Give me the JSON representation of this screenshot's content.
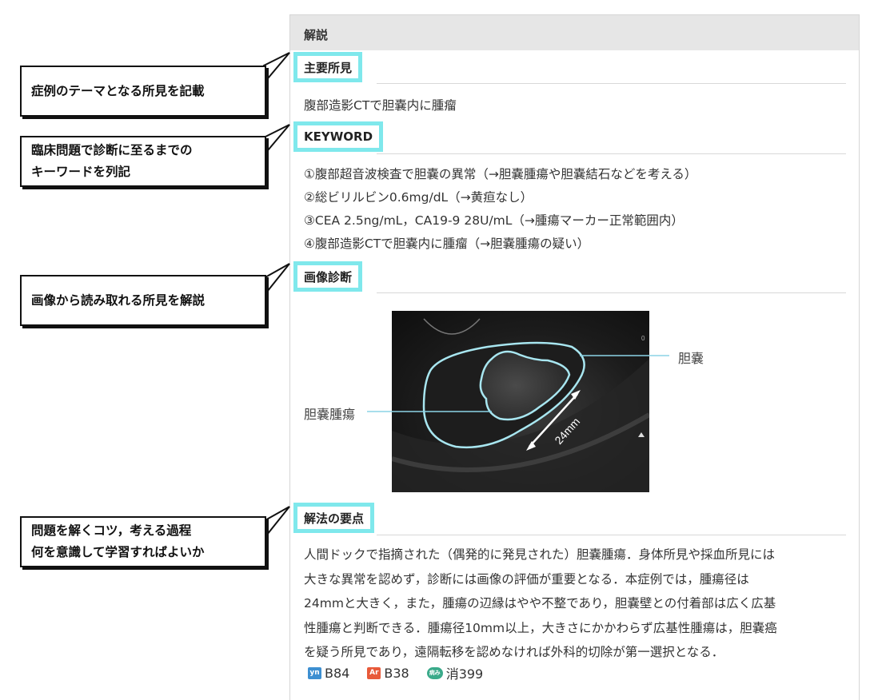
{
  "panel": {
    "header": "解説",
    "sections": {
      "findings": {
        "label": "主要所見",
        "text": "腹部造影CTで胆嚢内に腫瘤"
      },
      "keyword": {
        "label": "KEYWORD",
        "items": [
          "①腹部超音波検査で胆嚢の異常（→胆嚢腫瘍や胆嚢結石などを考える）",
          "②総ビリルビン0.6mg/dL（→黄疸なし）",
          "③CEA 2.5ng/mL，CA19-9 28U/mL（→腫瘍マーカー正常範囲内）",
          "④腹部造影CTで胆嚢内に腫瘤（→胆嚢腫瘍の疑い）"
        ]
      },
      "imaging": {
        "label": "画像診断",
        "label_gallbladder": "胆嚢",
        "label_tumor": "胆嚢腫瘍",
        "measurement": "24mm"
      },
      "approach": {
        "label": "解法の要点",
        "paragraph_lines": [
          "人間ドックで指摘された（偶発的に発見された）胆嚢腫瘍．身体所見や採血所見には",
          "大きな異常を認めず，診断には画像の評価が重要となる．本症例では，腫瘍径は",
          "24mmと大きく，また，腫瘍の辺縁はやや不整であり，胆嚢壁との付着部は広く広基",
          "性腫瘍と判断できる．腫瘍径10mm以上，大きさにかかわらず広基性腫瘍は，胆嚢癌",
          "を疑う所見であり，遠隔転移を認めなければ外科的切除が第一選択となる．"
        ],
        "refs": [
          {
            "badge": "yn",
            "value": "B84",
            "color": "#3d8fd1"
          },
          {
            "badge": "Ar",
            "value": "B38",
            "color": "#e85a3a"
          },
          {
            "badge": "病み",
            "value": "消399",
            "color": "#3aaa8a"
          }
        ]
      }
    }
  },
  "notes": [
    {
      "lines": [
        "症例のテーマとなる所見を記載"
      ]
    },
    {
      "lines": [
        "臨床問題で診断に至るまでの",
        "キーワードを列記"
      ]
    },
    {
      "lines": [
        "画像から読み取れる所見を解説"
      ]
    },
    {
      "lines": [
        "問題を解くコツ，考える過程",
        "何を意識して学習すればよいか"
      ]
    }
  ],
  "colors": {
    "highlight": "#7fe8ec",
    "outline": "#a8e6f0"
  }
}
